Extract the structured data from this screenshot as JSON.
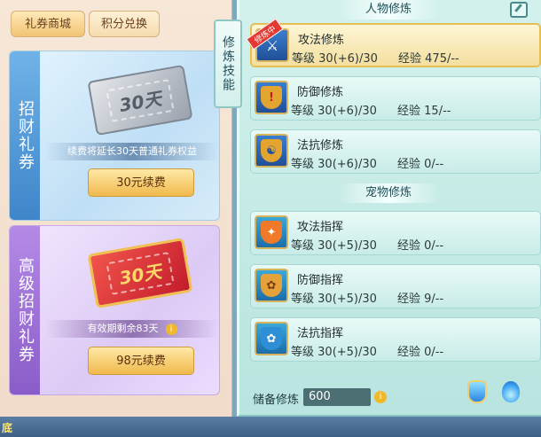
{
  "shop": {
    "tabs": {
      "shop": "礼券商城",
      "points": "积分兑换"
    },
    "cards": [
      {
        "tag": "招财礼券",
        "ticket_text": "30天",
        "desc": "续费将延长30天普通礼券权益",
        "button": "30元续费"
      },
      {
        "tag": "高级招财礼券",
        "ticket_text": "30天",
        "desc": "有效期剩余83天",
        "button": "98元续费"
      }
    ]
  },
  "skill_tab": "修炼技能",
  "headers": {
    "person": "人物修炼",
    "pet": "宠物修炼"
  },
  "labels": {
    "level": "等级",
    "exp": "经验",
    "training_badge": "修炼中"
  },
  "person_skills": [
    {
      "name": "攻法修炼",
      "level": "30(+6)/30",
      "exp": "475/--",
      "icon": "sword-icon"
    },
    {
      "name": "防御修炼",
      "level": "30(+6)/30",
      "exp": "15/--",
      "icon": "shield-icon"
    },
    {
      "name": "法抗修炼",
      "level": "30(+6)/30",
      "exp": "0/--",
      "icon": "yin-yang-icon"
    }
  ],
  "pet_skills": [
    {
      "name": "攻法指挥",
      "level": "30(+5)/30",
      "exp": "0/--",
      "icon": "pet-claw-icon"
    },
    {
      "name": "防御指挥",
      "level": "30(+5)/30",
      "exp": "9/--",
      "icon": "pet-paw-shield-icon"
    },
    {
      "name": "法抗指挥",
      "level": "30(+5)/30",
      "exp": "0/--",
      "icon": "pet-paw-icon"
    }
  ],
  "reserve": {
    "label": "储备修炼",
    "value": "600"
  },
  "bottom_text": "底",
  "colors": {
    "active_border": "#e3bf54",
    "panel_bg": "#c9ece8",
    "ribbon": "#e23a32"
  }
}
